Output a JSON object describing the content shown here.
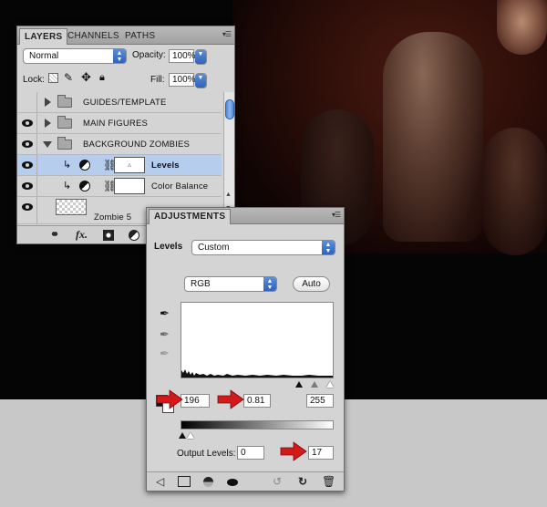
{
  "layers_panel": {
    "tabs": [
      "LAYERS",
      "CHANNELS",
      "PATHS"
    ],
    "blend_mode": "Normal",
    "opacity_label": "Opacity:",
    "opacity_value": "100%",
    "lock_label": "Lock:",
    "fill_label": "Fill:",
    "fill_value": "100%",
    "layers": [
      {
        "name": "GUIDES/TEMPLATE"
      },
      {
        "name": "MAIN FIGURES"
      },
      {
        "name": "BACKGROUND ZOMBIES"
      },
      {
        "name": "Levels"
      },
      {
        "name": "Color Balance"
      },
      {
        "name": "Zombie 5"
      }
    ],
    "fx_label": "fx."
  },
  "adjustments_panel": {
    "tab": "ADJUSTMENTS",
    "title": "Levels",
    "preset": "Custom",
    "channel": "RGB",
    "auto_label": "Auto",
    "input_black": "196",
    "input_gamma": "0.81",
    "input_white": "255",
    "output_label": "Output Levels:",
    "output_black": "0",
    "output_white": "17"
  },
  "colors": {
    "accent_blue": "#3d74c8",
    "selection": "#b6cdee",
    "annotation_red": "#d21a1a"
  },
  "icons": [
    "eye-icon",
    "folder-icon",
    "link-icon",
    "fx-icon",
    "mask-icon",
    "adjustment-icon",
    "eyedropper-icon",
    "back-arrow-icon",
    "reset-icon",
    "trash-icon"
  ]
}
